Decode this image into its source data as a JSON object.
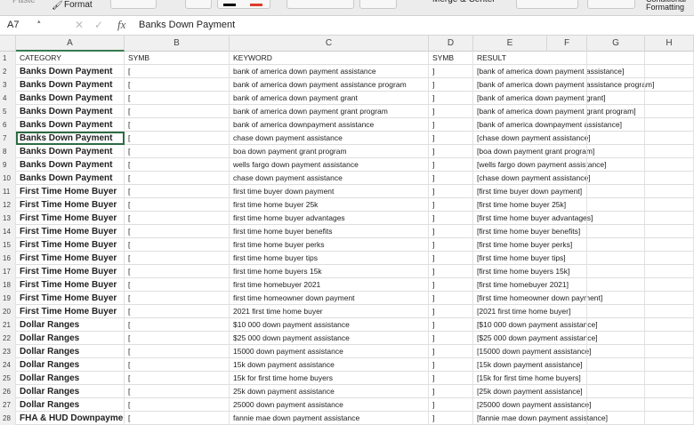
{
  "toolbar": {
    "format_label": "Format",
    "paste_label": "Paste",
    "merge_label": "Merge & Center",
    "conditional_label": "Conditional",
    "formatting_label": "Formatting"
  },
  "formula_bar": {
    "name_box": "A7",
    "fx": "fx",
    "content": "Banks Down Payment"
  },
  "columns": [
    "A",
    "B",
    "C",
    "D",
    "E",
    "F",
    "G",
    "H"
  ],
  "header": {
    "category": "CATEGORY",
    "symb1": "SYMB",
    "keyword": "KEYWORD",
    "symb2": "SYMB",
    "result": "RESULT"
  },
  "rows": [
    {
      "n": "2",
      "cat": "Banks Down Payment",
      "b": "[",
      "kw": "bank of america down payment assistance",
      "d": "]",
      "res": "[bank of america down payment assistance]"
    },
    {
      "n": "3",
      "cat": "Banks Down Payment",
      "b": "[",
      "kw": "bank of america down payment assistance program",
      "d": "]",
      "res": "[bank of america down payment assistance program]"
    },
    {
      "n": "4",
      "cat": "Banks Down Payment",
      "b": "[",
      "kw": "bank of america down payment grant",
      "d": "]",
      "res": "[bank of america down payment grant]"
    },
    {
      "n": "5",
      "cat": "Banks Down Payment",
      "b": "[",
      "kw": "bank of america down payment grant program",
      "d": "]",
      "res": "[bank of america down payment grant program]"
    },
    {
      "n": "6",
      "cat": "Banks Down Payment",
      "b": "[",
      "kw": "bank of america downpayment assistance",
      "d": "]",
      "res": "[bank of america downpayment assistance]"
    },
    {
      "n": "7",
      "cat": "Banks Down Payment",
      "b": "[",
      "kw": "chase down payment assistance",
      "d": "]",
      "res": "[chase down payment assistance]"
    },
    {
      "n": "8",
      "cat": "Banks Down Payment",
      "b": "[",
      "kw": "boa down payment grant program",
      "d": "]",
      "res": "[boa down payment grant program]"
    },
    {
      "n": "9",
      "cat": "Banks Down Payment",
      "b": "[",
      "kw": "wells fargo down payment assistance",
      "d": "]",
      "res": "[wells fargo down payment assistance]"
    },
    {
      "n": "10",
      "cat": "Banks Down Payment",
      "b": "[",
      "kw": "chase down payment assistance",
      "d": "]",
      "res": "[chase down payment assistance]"
    },
    {
      "n": "11",
      "cat": "First Time Home Buyer",
      "b": "[",
      "kw": "first time buyer down payment",
      "d": "]",
      "res": "[first time buyer down payment]"
    },
    {
      "n": "12",
      "cat": "First Time Home Buyer",
      "b": "[",
      "kw": "first time home buyer 25k",
      "d": "]",
      "res": "[first time home buyer 25k]"
    },
    {
      "n": "13",
      "cat": "First Time Home Buyer",
      "b": "[",
      "kw": "first time home buyer advantages",
      "d": "]",
      "res": "[first time home buyer advantages]"
    },
    {
      "n": "14",
      "cat": "First Time Home Buyer",
      "b": "[",
      "kw": "first time home buyer benefits",
      "d": "]",
      "res": "[first time home buyer benefits]"
    },
    {
      "n": "15",
      "cat": "First Time Home Buyer",
      "b": "[",
      "kw": "first time home buyer perks",
      "d": "]",
      "res": "[first time home buyer perks]"
    },
    {
      "n": "16",
      "cat": "First Time Home Buyer",
      "b": "[",
      "kw": "first time home buyer tips",
      "d": "]",
      "res": "[first time home buyer tips]"
    },
    {
      "n": "17",
      "cat": "First Time Home Buyer",
      "b": "[",
      "kw": "first time home buyers 15k",
      "d": "]",
      "res": "[first time home buyers 15k]"
    },
    {
      "n": "18",
      "cat": "First Time Home Buyer",
      "b": "[",
      "kw": "first time homebuyer 2021",
      "d": "]",
      "res": "[first time homebuyer 2021]"
    },
    {
      "n": "19",
      "cat": "First Time Home Buyer",
      "b": "[",
      "kw": "first time homeowner down payment",
      "d": "]",
      "res": "[first time homeowner down payment]"
    },
    {
      "n": "20",
      "cat": "First Time Home Buyer",
      "b": "[",
      "kw": "2021 first time home buyer",
      "d": "]",
      "res": "[2021 first time home buyer]"
    },
    {
      "n": "21",
      "cat": "Dollar Ranges",
      "b": "[",
      "kw": "$10 000 down payment assistance",
      "d": "]",
      "res": "[$10 000 down payment assistance]"
    },
    {
      "n": "22",
      "cat": "Dollar Ranges",
      "b": "[",
      "kw": "$25 000 down payment assistance",
      "d": "]",
      "res": "[$25 000 down payment assistance]"
    },
    {
      "n": "23",
      "cat": "Dollar Ranges",
      "b": "[",
      "kw": "15000 down payment assistance",
      "d": "]",
      "res": "[15000 down payment assistance]"
    },
    {
      "n": "24",
      "cat": "Dollar Ranges",
      "b": "[",
      "kw": "15k down payment assistance",
      "d": "]",
      "res": "[15k down payment assistance]"
    },
    {
      "n": "25",
      "cat": "Dollar Ranges",
      "b": "[",
      "kw": "15k for first time home buyers",
      "d": "]",
      "res": "[15k for first time home buyers]"
    },
    {
      "n": "26",
      "cat": "Dollar Ranges",
      "b": "[",
      "kw": "25k down payment assistance",
      "d": "]",
      "res": "[25k down payment assistance]"
    },
    {
      "n": "27",
      "cat": "Dollar Ranges",
      "b": "[",
      "kw": "25000 down payment assistance",
      "d": "]",
      "res": "[25000 down payment assistance]"
    },
    {
      "n": "28",
      "cat": "FHA & HUD Downpayme",
      "b": "[",
      "kw": "fannie mae down payment assistance",
      "d": "]",
      "res": "[fannie mae down payment assistance]"
    }
  ],
  "selected_cell": "A7"
}
